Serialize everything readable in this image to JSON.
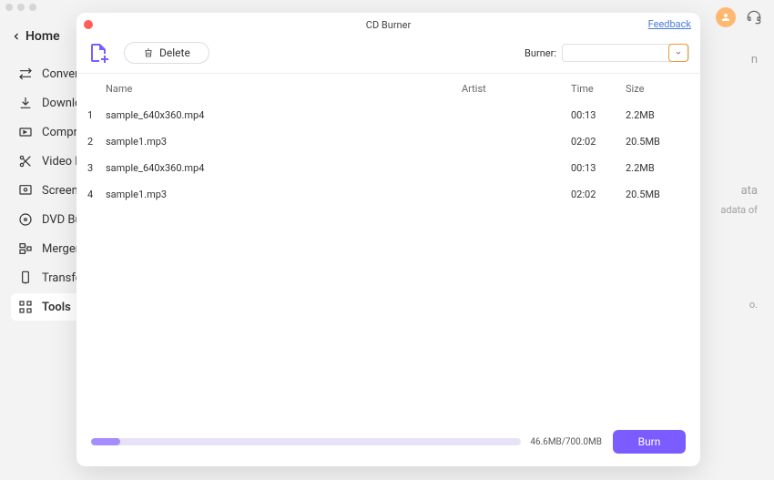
{
  "home_label": "Home",
  "sidebar": {
    "items": [
      {
        "label": "Conver"
      },
      {
        "label": "Downlo"
      },
      {
        "label": "Compre"
      },
      {
        "label": "Video E"
      },
      {
        "label": "Screen"
      },
      {
        "label": "DVD Bu"
      },
      {
        "label": "Merger"
      },
      {
        "label": "Transfe"
      },
      {
        "label": "Tools"
      }
    ]
  },
  "modal": {
    "title": "CD Burner",
    "feedback_label": "Feedback",
    "delete_label": "Delete",
    "burner_label": "Burner:",
    "columns": {
      "name": "Name",
      "artist": "Artist",
      "time": "Time",
      "size": "Size"
    },
    "rows": [
      {
        "num": "1",
        "name": "sample_640x360.mp4",
        "artist": "",
        "time": "00:13",
        "size": "2.2MB"
      },
      {
        "num": "2",
        "name": "sample1.mp3",
        "artist": "",
        "time": "02:02",
        "size": "20.5MB"
      },
      {
        "num": "3",
        "name": "sample_640x360.mp4",
        "artist": "",
        "time": "00:13",
        "size": "2.2MB"
      },
      {
        "num": "4",
        "name": "sample1.mp3",
        "artist": "",
        "time": "02:02",
        "size": "20.5MB"
      }
    ],
    "progress_text": "46.6MB/700.0MB",
    "burn_label": "Burn"
  },
  "bg": {
    "t1": "n",
    "t2": "ata",
    "t3": "adata of",
    "t4": "o."
  }
}
